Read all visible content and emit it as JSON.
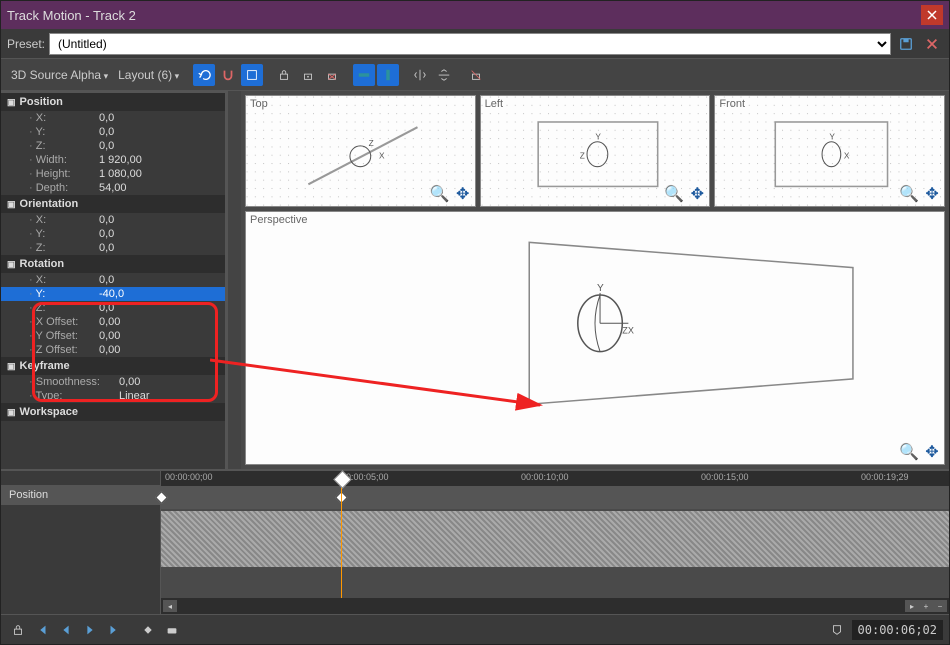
{
  "window": {
    "title": "Track Motion - Track 2"
  },
  "preset": {
    "label": "Preset:",
    "value": "(Untitled)"
  },
  "toolbar": {
    "mode": "3D Source Alpha",
    "layout": "Layout (6)"
  },
  "properties": {
    "position": {
      "header": "Position",
      "x_label": "X:",
      "x": "0,0",
      "y_label": "Y:",
      "y": "0,0",
      "z_label": "Z:",
      "z": "0,0",
      "w_label": "Width:",
      "width": "1 920,00",
      "h_label": "Height:",
      "height": "1 080,00",
      "d_label": "Depth:",
      "depth": "54,00"
    },
    "orientation": {
      "header": "Orientation",
      "x_label": "X:",
      "x": "0,0",
      "y_label": "Y:",
      "y": "0,0",
      "z_label": "Z:",
      "z": "0,0"
    },
    "rotation": {
      "header": "Rotation",
      "x_label": "X:",
      "x": "0,0",
      "y_label": "Y:",
      "y": "-40,0",
      "z_label": "Z:",
      "z": "0,0",
      "xo_label": "X Offset:",
      "xo": "0,00",
      "yo_label": "Y Offset:",
      "yo": "0,00",
      "zo_label": "Z Offset:",
      "zo": "0,00"
    },
    "keyframe": {
      "header": "Keyframe",
      "s_label": "Smoothness:",
      "smoothness": "0,00",
      "t_label": "Type:",
      "type": "Linear"
    },
    "workspace": {
      "header": "Workspace"
    }
  },
  "viewports": {
    "top": "Top",
    "left": "Left",
    "front": "Front",
    "perspective": "Perspective"
  },
  "timeline": {
    "track": "Position",
    "ticks": [
      "00:00:00;00",
      "00:00:05;00",
      "00:00:10;00",
      "00:00:15;00",
      "00:00:19;29"
    ],
    "timecode": "00:00:06;02"
  }
}
